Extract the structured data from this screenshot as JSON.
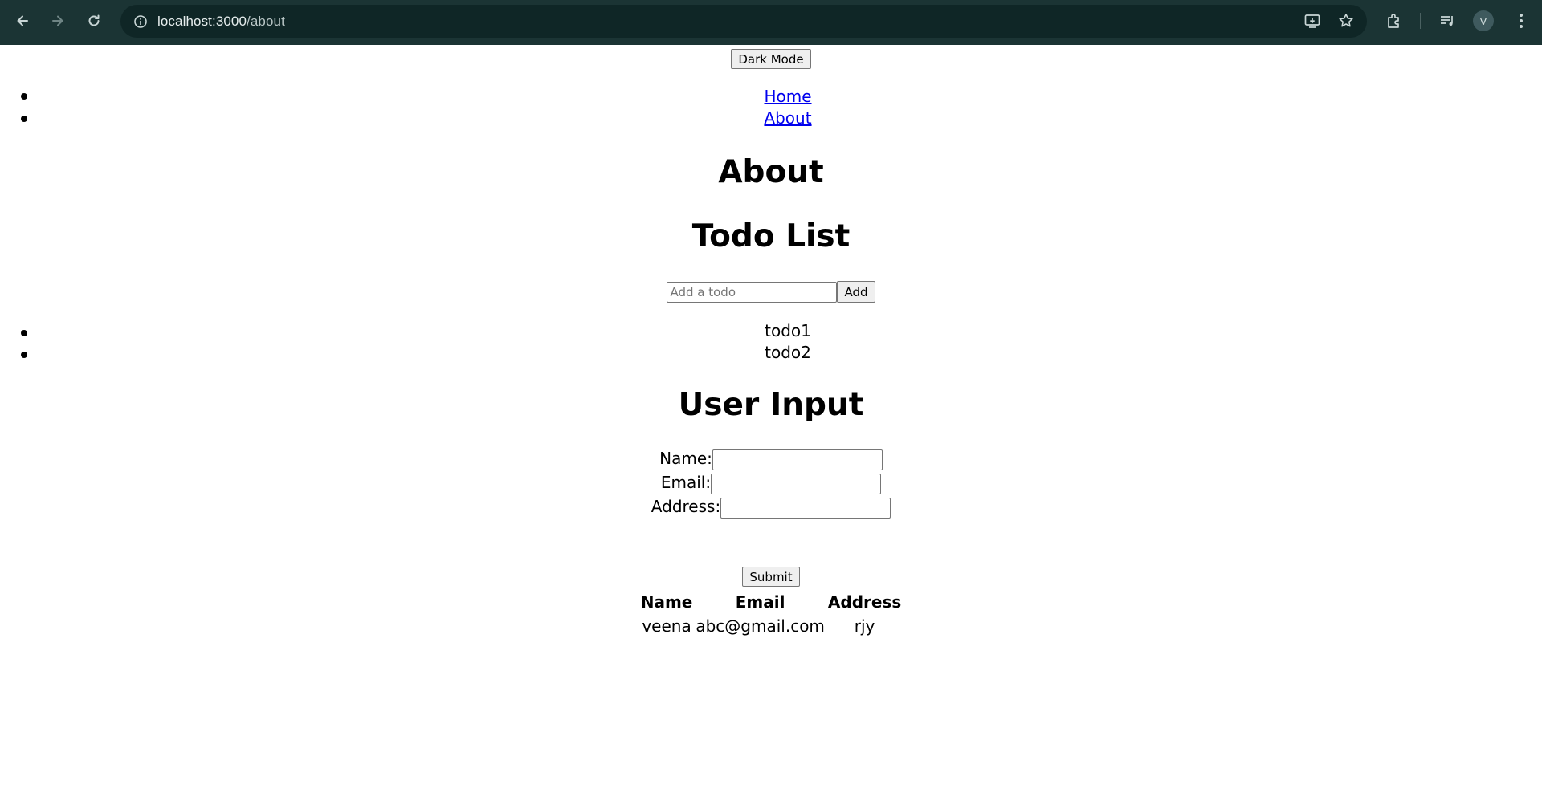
{
  "browser": {
    "url_host": "localhost:3000",
    "url_path": "/about",
    "profile_initial": "V"
  },
  "page": {
    "dark_mode_button": "Dark Mode",
    "nav_links": [
      "Home",
      "About"
    ],
    "about_heading": "About",
    "todo_heading": "Todo List",
    "todo_input_placeholder": "Add a todo",
    "add_button": "Add",
    "todos": [
      "todo1",
      "todo2"
    ],
    "user_input_heading": "User Input",
    "form": {
      "name_label": "Name:",
      "email_label": "Email:",
      "address_label": "Address:",
      "name_value": "",
      "email_value": "",
      "address_value": "",
      "submit_button": "Submit"
    },
    "table": {
      "headers": [
        "Name",
        "Email",
        "Address"
      ],
      "rows": [
        [
          "veena",
          "abc@gmail.com",
          "rjy"
        ]
      ]
    }
  },
  "colors": {
    "chrome_bg": "#1b3434",
    "omnibox_bg": "#0f2626",
    "link": "#0000ee"
  }
}
